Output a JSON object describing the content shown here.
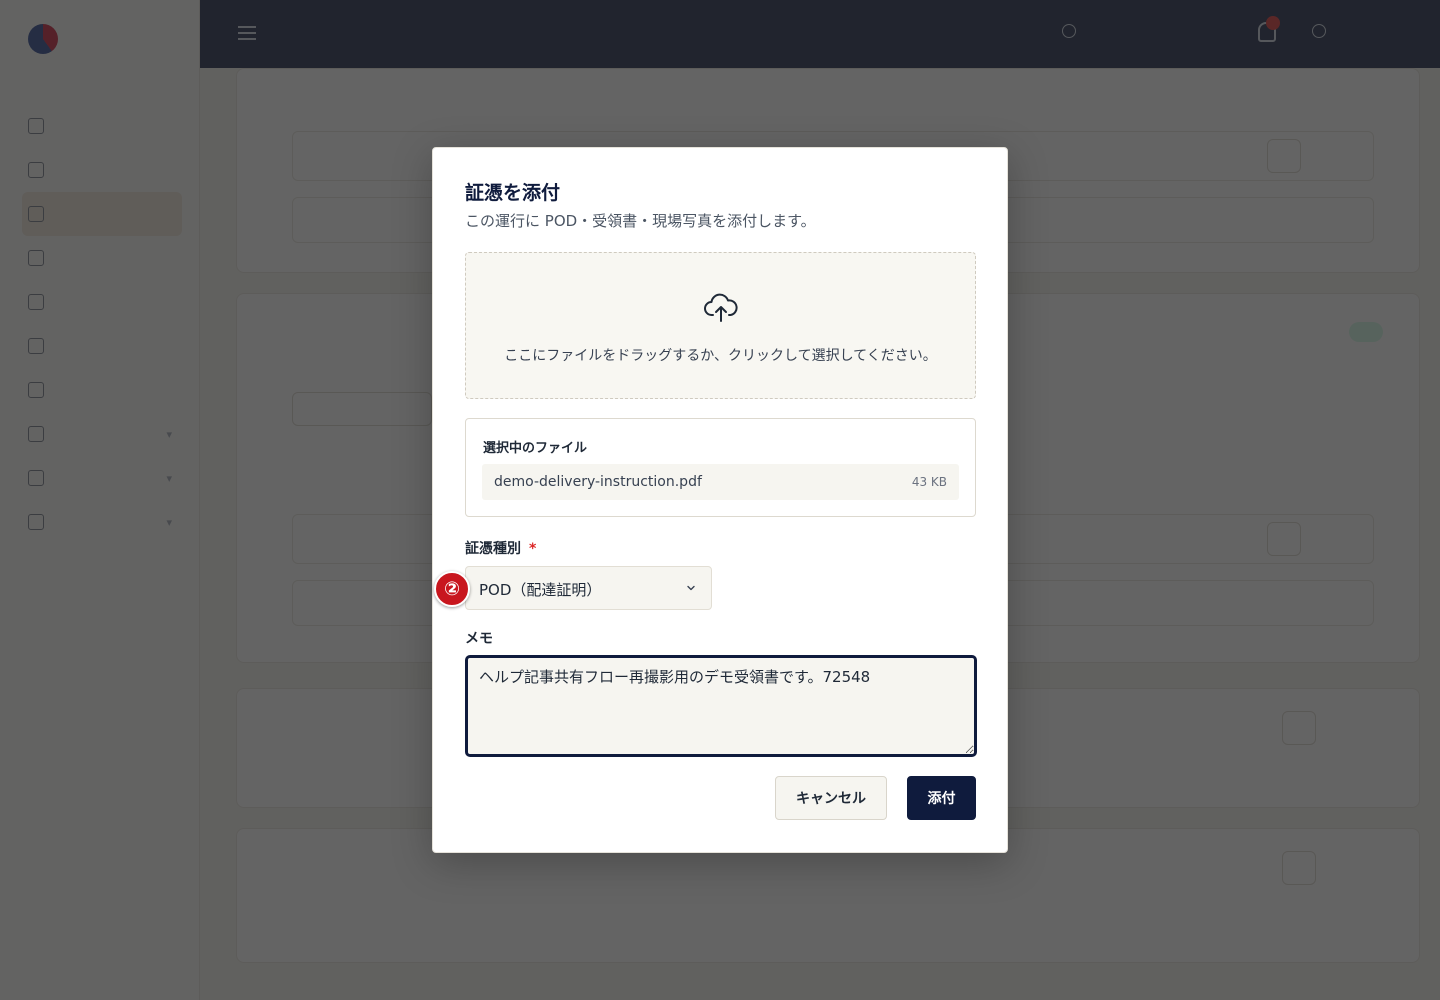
{
  "modal": {
    "title": "証憑を添付",
    "subtitle": "この運行に POD・受領書・現場写真を添付します。",
    "dropzone_text": "ここにファイルをドラッグするか、クリックして選択してください。",
    "selected_label": "選択中のファイル",
    "file": {
      "name": "demo-delivery-instruction.pdf",
      "size": "43 KB"
    },
    "type_label": "証憑種別",
    "required_mark": "*",
    "type_value": "POD（配達証明）",
    "memo_label": "メモ",
    "memo_value": "ヘルプ記事共有フロー再撮影用のデモ受領書です。72548",
    "cancel_label": "キャンセル",
    "attach_label": "添付"
  },
  "step_badge": "②",
  "colors": {
    "navy": "#0f1b3d",
    "required": "#dc2626",
    "badge": "#c8161e",
    "overlay": "rgba(40,40,40,0.72)"
  },
  "icons": [
    "upload-cloud-icon",
    "chevron-down-icon",
    "menu-icon",
    "bell-icon"
  ]
}
